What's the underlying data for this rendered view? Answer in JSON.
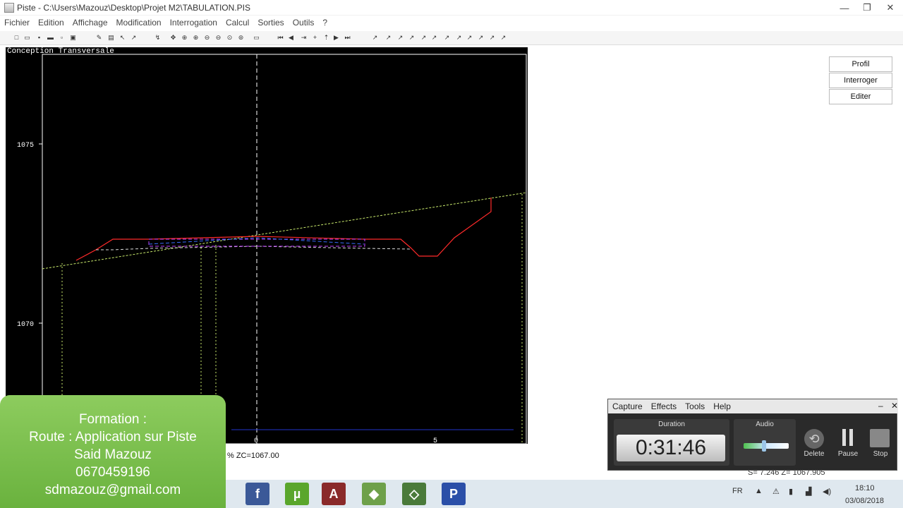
{
  "window": {
    "title": "Piste - C:\\Users\\Mazouz\\Desktop\\Projet M2\\TABULATION.PIS"
  },
  "menu": [
    "Fichier",
    "Edition",
    "Affichage",
    "Modification",
    "Interrogation",
    "Calcul",
    "Sorties",
    "Outils",
    "?"
  ],
  "panel": {
    "title": "Conception Transversale",
    "y_ticks": [
      "1075",
      "1070"
    ],
    "x_ticks": [
      "0",
      "5"
    ]
  },
  "right_buttons": [
    "Profil",
    "Interroger",
    "Editer"
  ],
  "status": {
    "text": "% ZC=1067.00",
    "coords": "S= 7.246  Z= 1067.905"
  },
  "overlay": {
    "line1": "Formation :",
    "line2": "Route : Application sur Piste",
    "line3": "Said Mazouz",
    "line4": "0670459196",
    "line5": "sdmazouz@gmail.com"
  },
  "recorder": {
    "menu": [
      "Capture",
      "Effects",
      "Tools",
      "Help"
    ],
    "duration_label": "Duration",
    "duration": "0:31:46",
    "audio_label": "Audio",
    "delete_label": "Delete",
    "pause_label": "Pause",
    "stop_label": "Stop",
    "audio_level": 0.45
  },
  "taskbar": {
    "lang": "FR",
    "time": "18:10",
    "date": "03/08/2018"
  },
  "colors": {
    "road": "#ff2a2a",
    "terrain": "#c7e86b",
    "overlay_green": "#7bbf4d"
  }
}
